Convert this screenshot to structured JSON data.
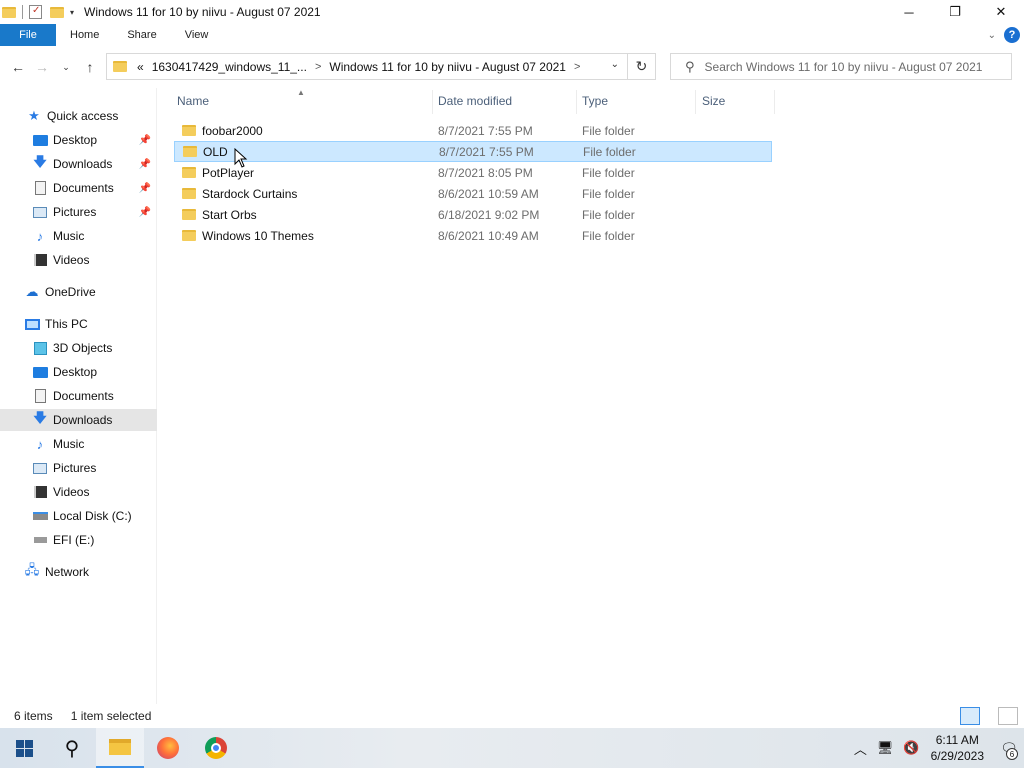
{
  "window": {
    "title": "Windows 11 for 10 by niivu - August 07 2021",
    "controls": {
      "minimize": "─",
      "restore": "❐",
      "close": "✕"
    }
  },
  "ribbon": {
    "tabs": [
      "File",
      "Home",
      "Share",
      "View"
    ]
  },
  "address": {
    "overflow": "«",
    "crumbs": [
      "1630417429_windows_11_...",
      "Windows 11 for 10 by niivu - August 07 2021"
    ],
    "separator": ">"
  },
  "search": {
    "placeholder": "Search Windows 11 for 10 by niivu - August 07 2021"
  },
  "sidebar": {
    "items": [
      {
        "label": "Quick access",
        "icon": "star-icon"
      },
      {
        "label": "Desktop",
        "icon": "desktop-icon",
        "pinned": true
      },
      {
        "label": "Downloads",
        "icon": "download-icon",
        "pinned": true
      },
      {
        "label": "Documents",
        "icon": "documents-icon",
        "pinned": true
      },
      {
        "label": "Pictures",
        "icon": "pictures-icon",
        "pinned": true
      },
      {
        "label": "Music",
        "icon": "music-icon"
      },
      {
        "label": "Videos",
        "icon": "videos-icon"
      },
      {
        "label": "OneDrive",
        "icon": "cloud-icon"
      },
      {
        "label": "This PC",
        "icon": "pc-icon"
      },
      {
        "label": "3D Objects",
        "icon": "3d-objects-icon"
      },
      {
        "label": "Desktop",
        "icon": "desktop-icon"
      },
      {
        "label": "Documents",
        "icon": "documents-icon"
      },
      {
        "label": "Downloads",
        "icon": "download-icon",
        "selected": true
      },
      {
        "label": "Music",
        "icon": "music-icon"
      },
      {
        "label": "Pictures",
        "icon": "pictures-icon"
      },
      {
        "label": "Videos",
        "icon": "videos-icon"
      },
      {
        "label": "Local Disk (C:)",
        "icon": "disk-icon"
      },
      {
        "label": "EFI (E:)",
        "icon": "drive-icon"
      },
      {
        "label": "Network",
        "icon": "network-icon"
      }
    ]
  },
  "columns": [
    "Name",
    "Date modified",
    "Type",
    "Size"
  ],
  "files": [
    {
      "name": "foobar2000",
      "date": "8/7/2021 7:55 PM",
      "type": "File folder"
    },
    {
      "name": "OLD",
      "date": "8/7/2021 7:55 PM",
      "type": "File folder",
      "selected": true
    },
    {
      "name": "PotPlayer",
      "date": "8/7/2021 8:05 PM",
      "type": "File folder"
    },
    {
      "name": "Stardock Curtains",
      "date": "8/6/2021 10:59 AM",
      "type": "File folder"
    },
    {
      "name": "Start Orbs",
      "date": "6/18/2021 9:02 PM",
      "type": "File folder"
    },
    {
      "name": "Windows 10 Themes",
      "date": "8/6/2021 10:49 AM",
      "type": "File folder"
    }
  ],
  "status": {
    "items_count": "6 items",
    "selected": "1 item selected"
  },
  "taskbar": {
    "time": "6:11 AM",
    "date": "6/29/2023",
    "notifications": "6"
  },
  "colors": {
    "file_tab": "#1979ca",
    "selection": "#cce8ff",
    "selection_border": "#99d1ff",
    "accent": "#3a8ee6"
  }
}
